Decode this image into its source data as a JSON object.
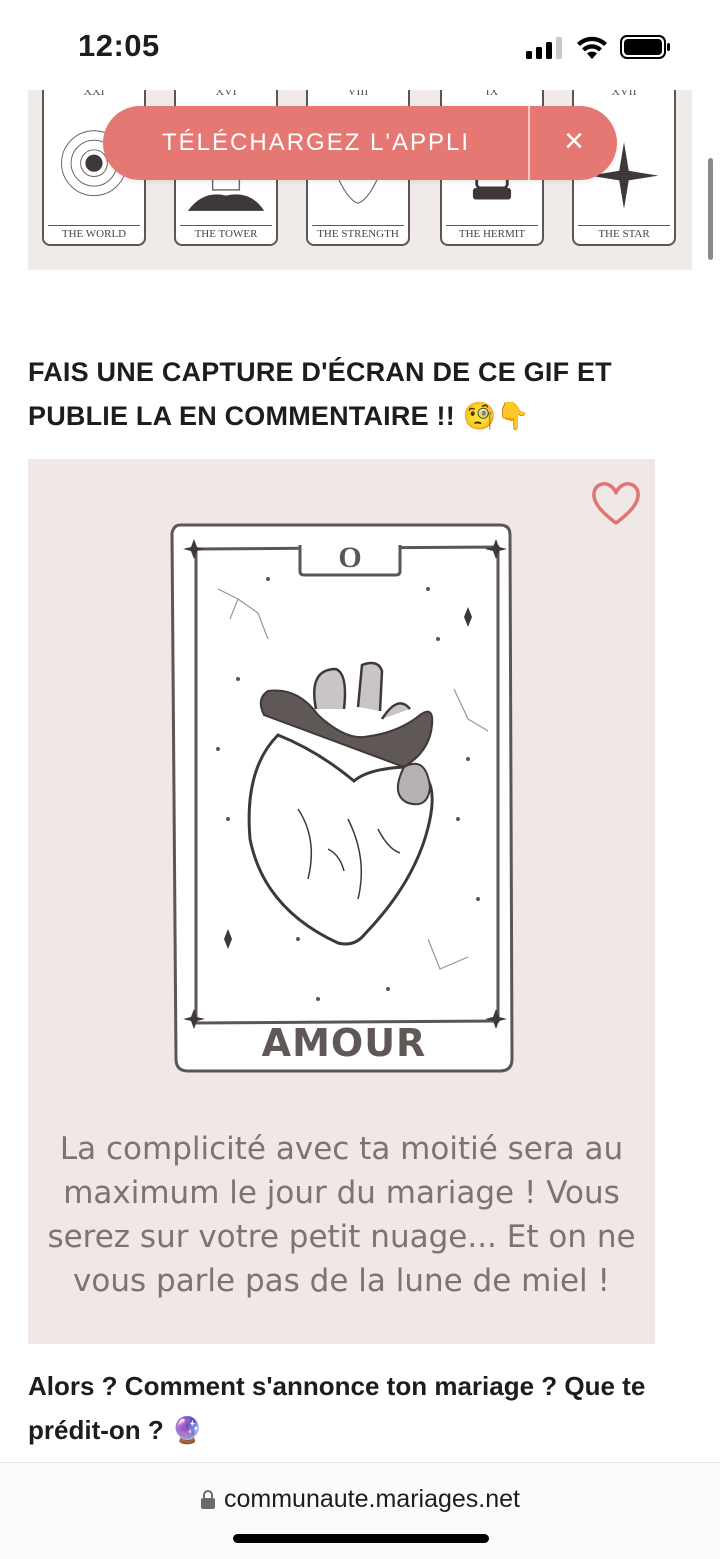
{
  "status_bar": {
    "time": "12:05"
  },
  "tarot_strip": {
    "cards": [
      {
        "number": "XXI",
        "name": "THE WORLD"
      },
      {
        "number": "XVI",
        "name": "THE TOWER"
      },
      {
        "number": "VIII",
        "name": "THE STRENGTH"
      },
      {
        "number": "IX",
        "name": "THE HERMIT"
      },
      {
        "number": "XVII",
        "name": "THE STAR"
      }
    ]
  },
  "app_banner": {
    "label": "TÉLÉCHARGEZ L'APPLI",
    "close_label": "×",
    "color": "#e57873"
  },
  "post": {
    "heading": "FAIS UNE CAPTURE D'ÉCRAN DE CE GIF ET PUBLIE LA EN COMMENTAIRE !!",
    "heading_emoji": "🧐👇",
    "gif": {
      "card_number": "O",
      "card_title": "AMOUR",
      "description": "La complicité avec ta moitié sera au maximum le jour du mariage ! Vous serez sur votre petit nuage... Et on ne vous parle pas de la lune de miel !"
    },
    "question": "Alors ? Comment s'annonce ton mariage ? Que te prédit-on ?",
    "question_emoji": "🔮"
  },
  "browser": {
    "url": "communaute.mariages.net"
  }
}
